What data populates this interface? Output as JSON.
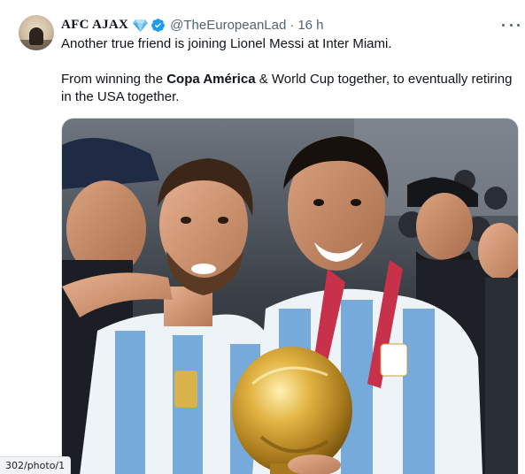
{
  "tweet": {
    "display_name": "AFC AJAX",
    "handle": "@TheEuropeanLad",
    "separator": "·",
    "time": "16 h",
    "text_line1": "Another true friend is joining Lionel Messi at Inter Miami.",
    "text_para2_a": "From winning the ",
    "text_para2_bold": "Copa América",
    "text_para2_b": " & World Cup together, to eventually retiring in the USA together.",
    "icons": [
      "avatar",
      "gem-icon",
      "verified-icon",
      "more-icon"
    ],
    "colors": {
      "verified": "#1d9bf0",
      "secondary_text": "#536471",
      "argentina_sky_blue": "#75aadb",
      "trophy_gold": "#c99a2e"
    }
  },
  "status_bar": {
    "url": "302/photo/1"
  }
}
